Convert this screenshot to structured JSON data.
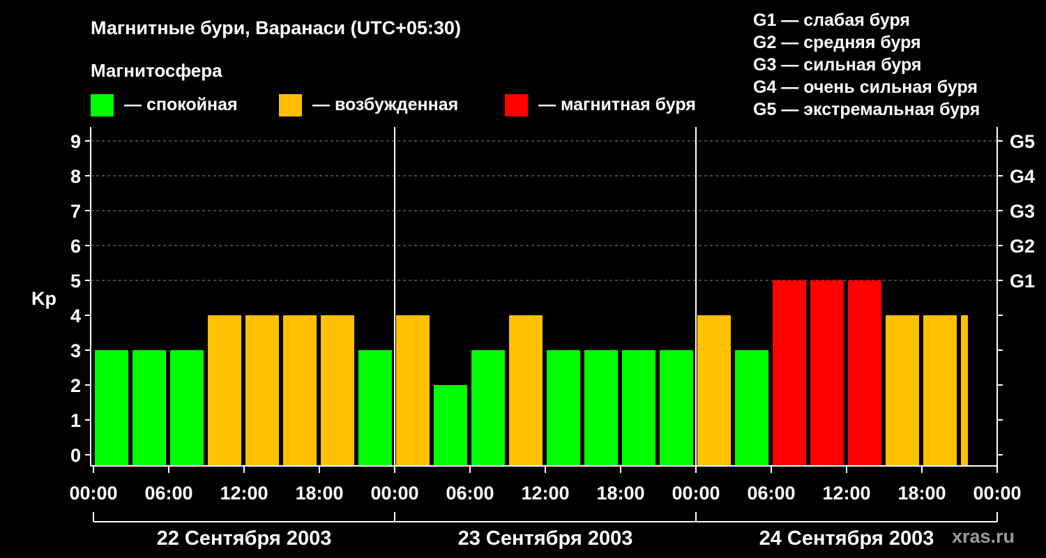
{
  "chart_data": {
    "type": "bar",
    "title": "Магнитные бури, Варанаси (UTC+05:30)",
    "subtitle": "Магнитосфера",
    "ylabel": "Kp",
    "ylim": [
      0,
      9
    ],
    "y_ticks": [
      "0",
      "1",
      "2",
      "3",
      "4",
      "5",
      "6",
      "7",
      "8",
      "9"
    ],
    "right_ticks": [
      {
        "value": 5,
        "label": "G1"
      },
      {
        "value": 6,
        "label": "G2"
      },
      {
        "value": 7,
        "label": "G3"
      },
      {
        "value": 8,
        "label": "G4"
      },
      {
        "value": 9,
        "label": "G5"
      }
    ],
    "x_ticks": [
      "00:00",
      "06:00",
      "12:00",
      "18:00",
      "00:00",
      "06:00",
      "12:00",
      "18:00",
      "00:00",
      "06:00",
      "12:00",
      "18:00",
      "00:00"
    ],
    "days": [
      "22 Сентября 2003",
      "23 Сентября 2003",
      "24 Сентября 2003"
    ],
    "bar_start_hours": [
      0,
      3,
      6,
      9,
      12,
      15,
      18,
      21,
      24,
      27,
      30,
      33,
      36,
      39,
      42,
      45,
      48,
      51,
      54,
      57,
      60,
      63,
      66,
      69
    ],
    "bar_hours": 3,
    "values": [
      3,
      3,
      3,
      4,
      4,
      4,
      4,
      3,
      4,
      2,
      3,
      4,
      3,
      3,
      3,
      3,
      4,
      3,
      5,
      5,
      5,
      4,
      4,
      4
    ],
    "status": [
      "quiet",
      "quiet",
      "quiet",
      "excited",
      "excited",
      "excited",
      "excited",
      "quiet",
      "excited",
      "quiet",
      "quiet",
      "excited",
      "quiet",
      "quiet",
      "quiet",
      "quiet",
      "excited",
      "quiet",
      "storm",
      "storm",
      "storm",
      "excited",
      "excited",
      "excited"
    ],
    "colors": {
      "quiet": "#00ff00",
      "excited": "#ffc000",
      "storm": "#ff0000"
    },
    "legend": [
      {
        "key": "quiet",
        "label": "— спокойная"
      },
      {
        "key": "excited",
        "label": "— возбужденная"
      },
      {
        "key": "storm",
        "label": "— магнитная буря"
      }
    ],
    "storm_levels": [
      "G1 — слабая буря",
      "G2 — средняя буря",
      "G3 — сильная буря",
      "G4 — очень сильная буря",
      "G5 — экстремальная буря"
    ],
    "grid": true,
    "legend_position": "top"
  },
  "watermark": "xras.ru"
}
